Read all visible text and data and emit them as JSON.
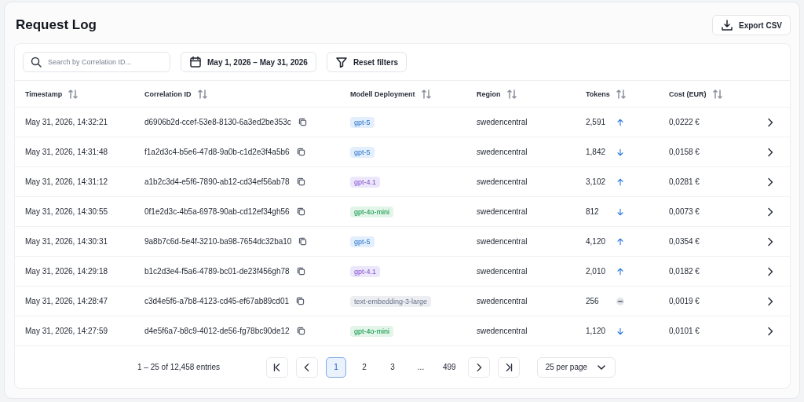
{
  "title": "Request Log",
  "export_button": "Export CSV",
  "filters": {
    "search": {
      "placeholder": "Search by Correlation ID..."
    },
    "date_range": "May 1, 2026 – May 31, 2026",
    "reset_button": "Reset filters"
  },
  "table": {
    "columns": [
      "Timestamp",
      "Correlation ID",
      "Modell Deployment",
      "Region",
      "Tokens",
      "Cost (EUR)"
    ],
    "rows": [
      {
        "timestamp": "May 31, 2026, 14:32:21",
        "correlation_id": "d6906b2d-ccef-53e8-8130-6a3ed2be353c",
        "model": "gpt-5",
        "color": "#e4effd",
        "region": "swedencentral",
        "tokens": "2,591",
        "kind": "up",
        "cost": "0,0222 €"
      },
      {
        "timestamp": "May 31, 2026, 14:31:48",
        "correlation_id": "f1a2d3c4-b5e6-47d8-9a0b-c1d2e3f4a5b6",
        "model": "gpt-5",
        "color": "#e4effd",
        "region": "swedencentral",
        "tokens": "1,842",
        "kind": "down",
        "cost": "0,0158 €"
      },
      {
        "timestamp": "May 31, 2026, 14:31:12",
        "correlation_id": "a1b2c3d4-e5f6-7890-ab12-cd34ef56ab78",
        "model": "gpt-4.1",
        "color": "#ece7fb",
        "region": "swedencentral",
        "tokens": "3,102",
        "kind": "up",
        "cost": "0,0281 €"
      },
      {
        "timestamp": "May 31, 2026, 14:30:55",
        "correlation_id": "0f1e2d3c-4b5a-6978-90ab-cd12ef34gh56",
        "model": "gpt-4o-mini",
        "color": "#e2f5e8",
        "region": "swedencentral",
        "tokens": "812",
        "kind": "down",
        "cost": "0,0073 €"
      },
      {
        "timestamp": "May 31, 2026, 14:30:31",
        "correlation_id": "9a8b7c6d-5e4f-3210-ba98-7654dc32ba10",
        "model": "gpt-5",
        "color": "#e4effd",
        "region": "swedencentral",
        "tokens": "4,120",
        "kind": "up",
        "cost": "0,0354 €"
      },
      {
        "timestamp": "May 31, 2026, 14:29:18",
        "correlation_id": "b1c2d3e4-f5a6-4789-bc01-de23f456gh78",
        "model": "gpt-4.1",
        "color": "#ece7fb",
        "region": "swedencentral",
        "tokens": "2,010",
        "kind": "up",
        "cost": "0,0182 €"
      },
      {
        "timestamp": "May 31, 2026, 14:28:47",
        "correlation_id": "c3d4e5f6-a7b8-4123-cd45-ef67ab89cd01",
        "model": "text-embedding-3-large",
        "color": "#eceef2",
        "region": "swedencentral",
        "tokens": "256",
        "kind": "flat",
        "cost": "0,0019 €"
      },
      {
        "timestamp": "May 31, 2026, 14:27:59",
        "correlation_id": "d4e5f6a7-b8c9-4012-de56-fg78bc90de12",
        "model": "gpt-4o-mini",
        "color": "#e2f5e8",
        "region": "swedencentral",
        "tokens": "1,120",
        "kind": "down",
        "cost": "0,0101 €"
      }
    ]
  },
  "pagination": {
    "summary": "1 – 25 of 12,458 entries",
    "pages": [
      {
        "label": "1",
        "selected": true
      },
      {
        "label": "2",
        "selected": false
      },
      {
        "label": "3",
        "selected": false
      },
      {
        "label": "...",
        "selected": false
      },
      {
        "label": "499",
        "selected": false
      }
    ],
    "page_size": "25 per page"
  }
}
